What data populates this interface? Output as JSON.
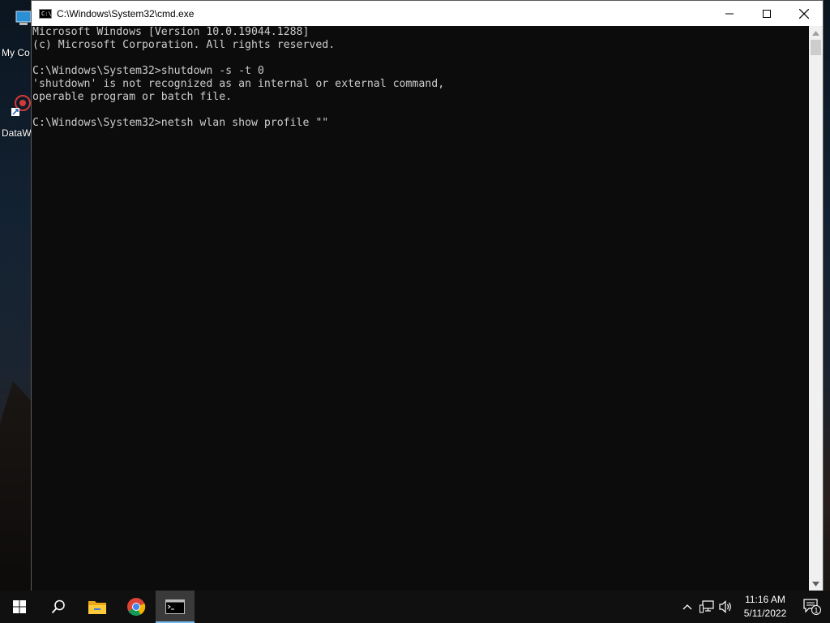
{
  "desktop": {
    "icons": [
      {
        "label": "My Co",
        "icon": "computer-icon"
      },
      {
        "label": "DataW",
        "icon": "app-shortcut-icon"
      }
    ]
  },
  "window": {
    "title": "C:\\Windows\\System32\\cmd.exe",
    "minimize": "minimize",
    "maximize": "maximize",
    "close": "close"
  },
  "console": {
    "lines": [
      "Microsoft Windows [Version 10.0.19044.1288]",
      "(c) Microsoft Corporation. All rights reserved.",
      "",
      "C:\\Windows\\System32>shutdown -s -t 0",
      "'shutdown' is not recognized as an internal or external command,",
      "operable program or batch file.",
      "",
      "C:\\Windows\\System32>netsh wlan show profile \"\""
    ]
  },
  "taskbar": {
    "start": "start-icon",
    "search": "search-icon",
    "apps": [
      "file-explorer-icon",
      "chrome-icon",
      "cmd-icon"
    ],
    "tray": {
      "time": "11:16 AM",
      "date": "5/11/2022",
      "notification_count": "1"
    }
  },
  "colors": {
    "console_bg": "#0c0c0c",
    "console_text": "#cccccc",
    "accent": "#76b9ed"
  }
}
